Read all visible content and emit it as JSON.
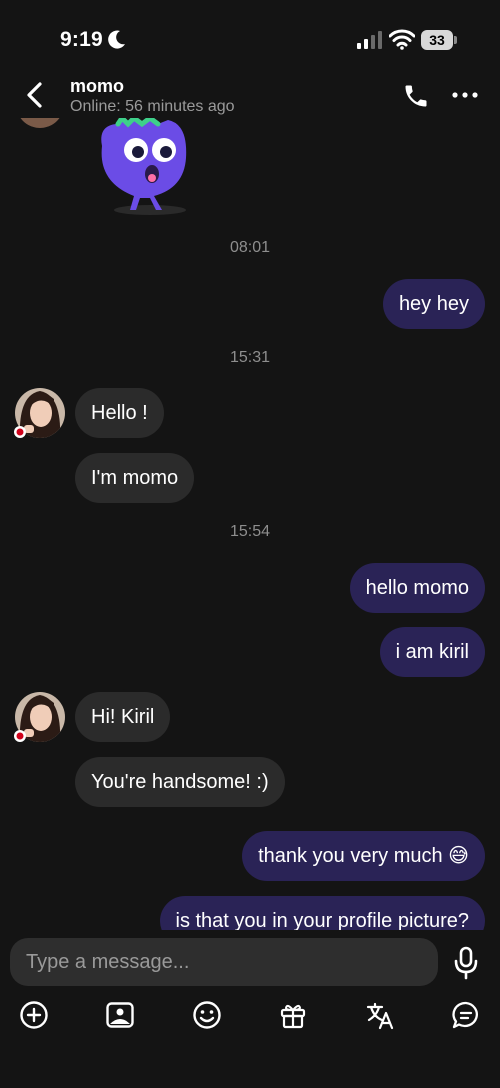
{
  "status_bar": {
    "time": "9:19",
    "battery": "33"
  },
  "header": {
    "name": "momo",
    "status": "Online: 56 minutes ago"
  },
  "messages": [
    {
      "type": "time",
      "text": "08:01"
    },
    {
      "type": "out",
      "text": "hey hey"
    },
    {
      "type": "time",
      "text": "15:31"
    },
    {
      "type": "in",
      "text": "Hello !"
    },
    {
      "type": "in",
      "text": "I'm momo"
    },
    {
      "type": "time",
      "text": "15:54"
    },
    {
      "type": "out",
      "text": "hello momo"
    },
    {
      "type": "out",
      "text": "i am kiril"
    },
    {
      "type": "in",
      "text": "Hi! Kiril"
    },
    {
      "type": "in",
      "text": "You're handsome! :)"
    },
    {
      "type": "out",
      "text": "thank you very much 😅"
    },
    {
      "type": "out",
      "text": "is that you in your profile picture?"
    }
  ],
  "composer": {
    "placeholder": "Type a message..."
  },
  "toolbar": [
    "plus-icon",
    "image-icon",
    "emoji-icon",
    "gift-icon",
    "translate-icon",
    "chat-bubble-icon"
  ],
  "colors": {
    "background": "#141414",
    "incoming_bubble": "#2b2b2b",
    "outgoing_bubble": "#2a2356",
    "muted_text": "#8e8e8e",
    "sticker_purple": "#6b4ce6",
    "sticker_green": "#3ed08a"
  }
}
